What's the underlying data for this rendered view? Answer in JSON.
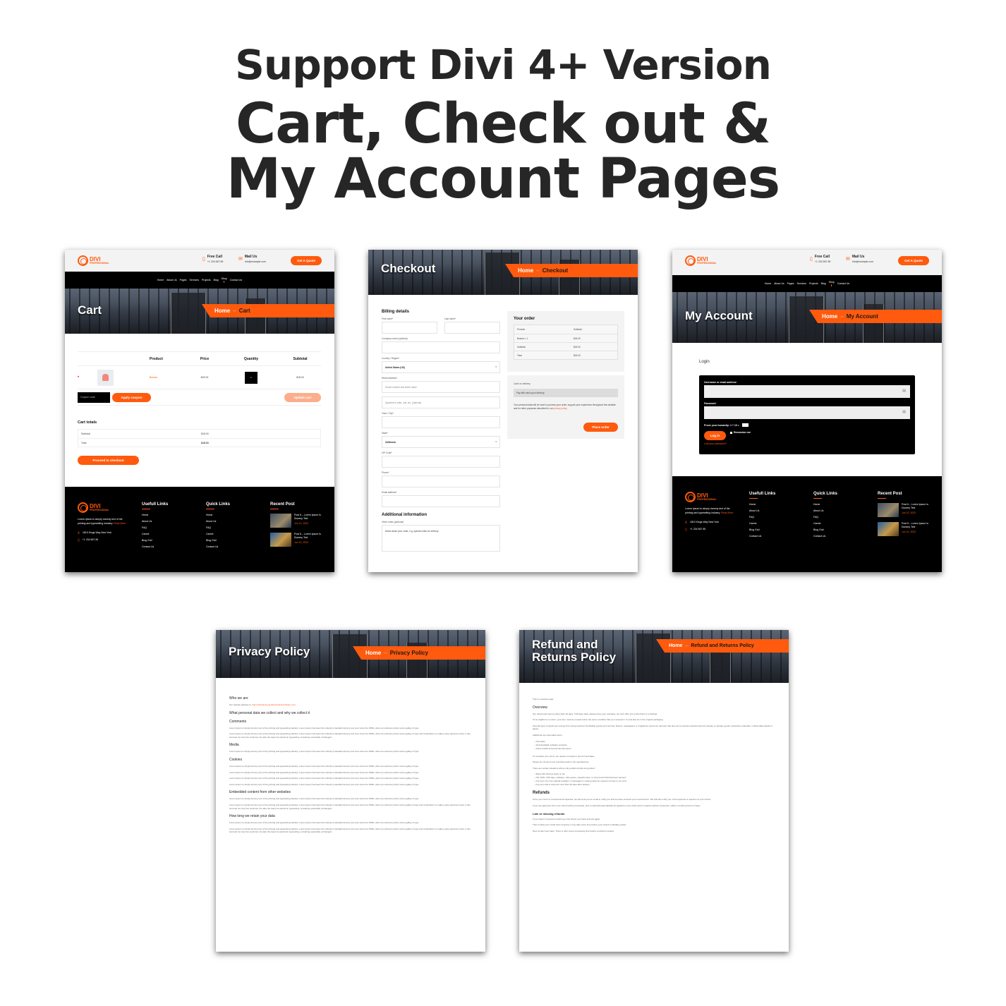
{
  "headline": {
    "line1": "Support Divi 4+ Version",
    "line2": "Cart, Check out &",
    "line3": "My Account Pages"
  },
  "site": {
    "logo_name": "DIVI",
    "logo_sub": "PROFESSIONAL",
    "call_label": "Free Call",
    "call_value": "+1 234 567 89",
    "mail_label": "Mail Us",
    "mail_value": "info@example.com",
    "quote_button": "Get A Quote",
    "nav": [
      "Home",
      "About Us",
      "Pages",
      "Services",
      "Projects",
      "Blog",
      "Shop",
      "Contact Us"
    ],
    "active_nav": "Shop",
    "accent_color": "#ff5a0d",
    "crumb_home": "Home",
    "crumb_sep": "–"
  },
  "footer": {
    "about_text": "Lorem Ipsum is simply dummy text of the printing and typesetting industry.",
    "read_more": "Read More",
    "address": "1810 Kings Way New York",
    "phone": "+1 234 567 89",
    "useful_title": "Usefull Links",
    "useful_links": [
      "Home",
      "About Us",
      "FAQ",
      "Career",
      "Blog Grid",
      "Contact Us"
    ],
    "quick_title": "Quick Links",
    "quick_links": [
      "Home",
      "About Us",
      "FAQ",
      "Career",
      "Blog Grid",
      "Contact Us"
    ],
    "recent_title": "Recent Post",
    "posts": [
      {
        "title": "Post 6 – Lorem Ipsum Is Dummy Text",
        "date": "Jun 13, 2022"
      },
      {
        "title": "Post 5 – Lorem Ipsum Is Dummy Text",
        "date": "Jun 13, 2022"
      }
    ]
  },
  "cart": {
    "title": "Cart",
    "headers": [
      "",
      "",
      "Product",
      "Price",
      "Quantity",
      "Subtotal"
    ],
    "item": {
      "name": "Bosnia",
      "price": "$18.00",
      "qty": "1",
      "subtotal": "$18.00"
    },
    "coupon_placeholder": "Coupon code",
    "apply_coupon": "Apply coupon",
    "update_cart": "Update cart",
    "totals_title": "Cart totals",
    "totals": [
      {
        "label": "Subtotal",
        "value": "$18.00"
      },
      {
        "label": "Total",
        "value": "$18.00"
      }
    ],
    "checkout_button": "Proceed to checkout"
  },
  "checkout": {
    "title": "Checkout",
    "billing_title": "Billing details",
    "first_name": "First name",
    "last_name": "Last name",
    "company": "Company name (optional)",
    "country": "Country / Region",
    "country_value": "United States (US)",
    "street": "Street address",
    "street_ph": "House number and street name",
    "apt_ph": "Apartment, suite, unit, etc. (optional)",
    "city": "Town / City",
    "state": "State",
    "state_value": "California",
    "zip": "ZIP Code",
    "phone": "Phone",
    "email": "Email address",
    "additional_title": "Additional information",
    "notes_label": "Order notes (optional)",
    "notes_ph": "Notes about your order, e.g. special notes for delivery.",
    "order_title": "Your order",
    "order_rows": [
      {
        "label": "Product",
        "value": "Subtotal"
      },
      {
        "label": "Bosnia  × 1",
        "value": "$18.00"
      },
      {
        "label": "Subtotal",
        "value": "$18.00"
      },
      {
        "label": "Total",
        "value": "$18.00"
      }
    ],
    "payment_method": "Cash on delivery",
    "payment_note": "Pay with cash upon delivery.",
    "privacy_text": "Your personal data will be used to process your order, support your experience throughout this website, and for other purposes described in our",
    "privacy_link": "privacy policy.",
    "place_order": "Place order"
  },
  "account": {
    "title": "My Account",
    "login_title": "Login",
    "username_label": "Username or email address",
    "password_label": "Password",
    "humanity_label": "Prove your humanity: 1  +  10  =",
    "login_button": "Log in",
    "remember": "Remember me",
    "lost_password": "Lost your password?"
  },
  "privacy": {
    "title": "Privacy Policy",
    "who_title": "Who we are",
    "who_text": "Our website address is:",
    "who_link": "https://diviFactoryandindustrial.diviinfinite.com/",
    "collect_title": "What personal data we collect and why we collect it",
    "lorem_short": "Lorem Ipsum is simply dummy text of the printing and typesetting industry. Lorem Ipsum has been the industry's standard dummy text ever since the 1500s, when an unknown printer took a galley of type",
    "lorem_long": "Lorem Ipsum is simply dummy text of the printing and typesetting industry. Lorem Ipsum has been the industry's standard dummy text ever since the 1500s, when an unknown printer took a galley of type and scrambled it to make a type specimen book. It has survived not only five centuries, but also the leap into electronic typesetting, remaining essentially unchanged.",
    "comments": "Comments",
    "media": "Media",
    "cookies": "Cookies",
    "embedded": "Embedded content from other websites",
    "retain": "How long we retain your data"
  },
  "refund": {
    "title": "Refund and Returns Policy",
    "sample": "This is a sample page.",
    "overview": "Overview",
    "p1": "Our refund and returns policy lasts 30 days. If 30 days have passed since your purchase, we can't offer you a full refund or exchange.",
    "p2": "To be eligible for a return, your item must be unused and in the same condition that you received it. It must also be in the original packaging.",
    "p3": "Several types of goods are exempt from being returned. Perishable goods such as food, flowers, newspapers or magazines cannot be returned. We also do not accept products that are intimate or sanitary goods, hazardous materials, or flammable liquids or gases.",
    "p4": "Additional non-returnable items:",
    "list1": [
      "Gift cards",
      "Downloadable software products",
      "Some health and personal care items"
    ],
    "p5": "To complete your return, we require a receipt or proof of purchase.",
    "p6": "Please do not send your purchase back to the manufacturer.",
    "p7": "There are certain situations where only partial refunds are granted:",
    "list2": [
      "Book with obvious signs of use",
      "CD, DVD, VHS tape, software, video game, cassette tape, or vinyl record that has been opened.",
      "Any item not in its original condition, is damaged or missing parts for reasons not due to our error.",
      "Any item that is returned more than 30 days after delivery"
    ],
    "refunds": "Refunds",
    "p8": "Once your return is received and inspected, we will send you an email to notify you that we have received your returned item. We will also notify you of the approval or rejection of your refund.",
    "p9": "If you are approved, then your refund will be processed, and a credit will automatically be applied to your credit card or original method of payment, within a certain amount of days.",
    "late": "Late or missing refunds",
    "p10": "If you haven't received a refund yet, first check your bank account again.",
    "p11": "Then contact your credit card company, it may take some time before your refund is officially posted.",
    "p12": "Next contact your bank. There is often some processing time before a refund is posted."
  }
}
